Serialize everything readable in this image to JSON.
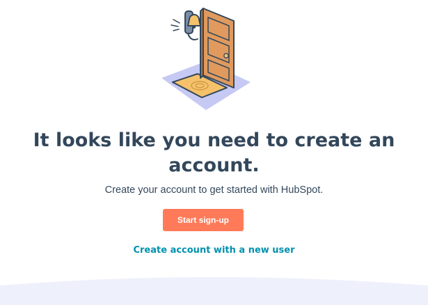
{
  "page": {
    "heading": "It looks like you need to create an account.",
    "subtext": "Create your account to get started with HubSpot.",
    "primary_button_label": "Start sign-up",
    "secondary_link_label": "Create account with a new user"
  },
  "illustration": {
    "alt": "Door with doorbell and welcome mat",
    "icons": [
      "doorbell-icon",
      "door-icon",
      "welcome-mat-icon"
    ]
  },
  "colors": {
    "heading": "#33475b",
    "primary_button": "#ff7a59",
    "link": "#0091ae",
    "door": "#e09a5e",
    "mat": "#f5c26b",
    "floor_shadow": "#c5c9f3",
    "footer_wave": "#eef0fb"
  }
}
